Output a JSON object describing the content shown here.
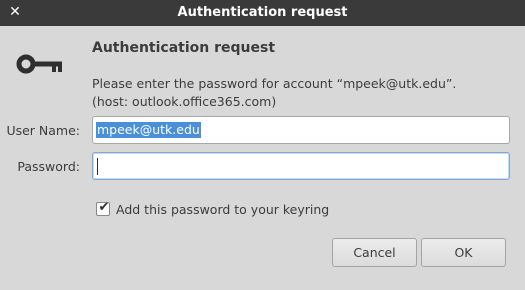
{
  "window": {
    "title": "Authentication request",
    "close_icon": "close-icon"
  },
  "dialog": {
    "icon": "key-icon",
    "heading": "Authentication request",
    "message": "Please enter the password for account “mpeek@utk.edu”.",
    "host": "(host: outlook.office365.com)"
  },
  "form": {
    "username_label": "User Name:",
    "username_value": "mpeek@utk.edu",
    "password_label": "Password:",
    "password_value": ""
  },
  "keyring": {
    "label": "Add this password to your keyring",
    "checked": true
  },
  "buttons": {
    "cancel": "Cancel",
    "ok": "OK"
  },
  "colors": {
    "titlebar": "#3a3a3a",
    "background": "#d8d8d8",
    "selection": "#4a90d9",
    "focus": "#7fa7d4"
  }
}
